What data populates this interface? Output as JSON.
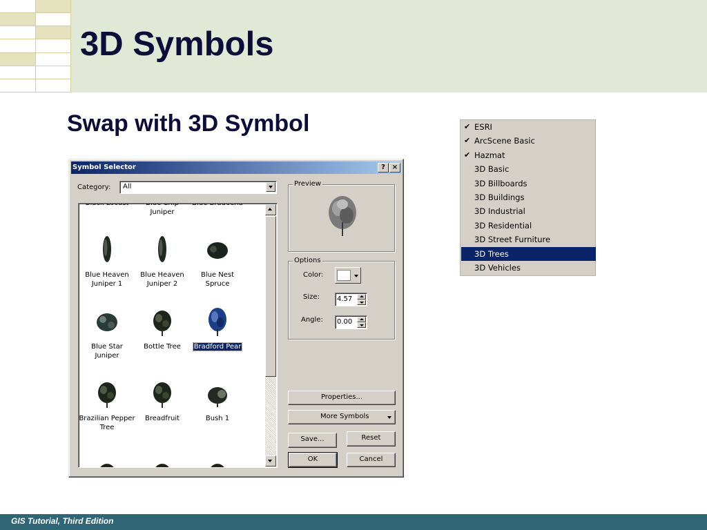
{
  "slide": {
    "title": "3D Symbols",
    "subtitle": "Swap with 3D Symbol",
    "footer": "GIS Tutorial, Third Edition"
  },
  "dialog": {
    "title": "Symbol Selector",
    "help_button": "?",
    "close_button": "×",
    "category_label": "Category:",
    "category_value": "All",
    "symbols": [
      {
        "label": "Black Locust",
        "icon": "tree-icon"
      },
      {
        "label": "Blue Chip\nJuniper",
        "icon": "tree-icon"
      },
      {
        "label": "Blue Bradeena",
        "icon": "tree-icon"
      },
      {
        "label": "Blue Heaven\nJuniper 1",
        "icon": "columnar-tree-icon"
      },
      {
        "label": "Blue Heaven\nJuniper 2",
        "icon": "columnar-tree-icon"
      },
      {
        "label": "Blue Nest\nSpruce",
        "icon": "spruce-icon"
      },
      {
        "label": "Blue Star Juniper",
        "icon": "shrub-icon"
      },
      {
        "label": "Bottle Tree",
        "icon": "tree-icon"
      },
      {
        "label": "Bradford Pear",
        "icon": "pear-tree-icon",
        "selected": true
      },
      {
        "label": "Brazilian Pepper\nTree",
        "icon": "tree-icon"
      },
      {
        "label": "Breadfruit",
        "icon": "tree-icon"
      },
      {
        "label": "Bush 1",
        "icon": "bush-icon"
      }
    ],
    "preview_label": "Preview",
    "options_label": "Options",
    "color_label": "Color:",
    "color_value": "#ffffff",
    "size_label": "Size:",
    "size_value": "4.57",
    "angle_label": "Angle:",
    "angle_value": "0.00",
    "properties_button": "Properties...",
    "more_symbols_button": "More Symbols",
    "save_button": "Save...",
    "reset_button": "Reset",
    "ok_button": "OK",
    "cancel_button": "Cancel"
  },
  "style_menu": {
    "items": [
      {
        "label": "ESRI",
        "checked": true
      },
      {
        "label": "ArcScene Basic",
        "checked": true
      },
      {
        "label": "Hazmat",
        "checked": true
      },
      {
        "label": "3D Basic",
        "checked": false
      },
      {
        "label": "3D Billboards",
        "checked": false
      },
      {
        "label": "3D Buildings",
        "checked": false
      },
      {
        "label": "3D Industrial",
        "checked": false
      },
      {
        "label": "3D Residential",
        "checked": false
      },
      {
        "label": "3D Street Furniture",
        "checked": false
      },
      {
        "label": "3D Trees",
        "checked": false,
        "highlighted": true
      },
      {
        "label": "3D Vehicles",
        "checked": false
      }
    ]
  },
  "colors": {
    "header_bg": "#e1e8d6",
    "footer_bg": "#2e6676",
    "title_text": "#0d0d3a",
    "selection": "#0a246a",
    "dialog_face": "#d4d0c8"
  }
}
